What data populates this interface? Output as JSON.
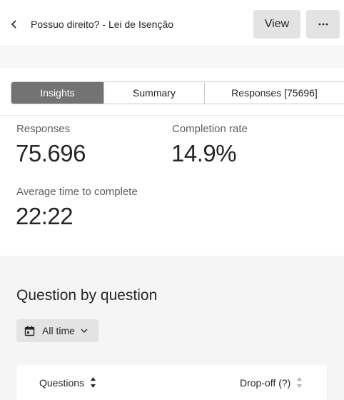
{
  "header": {
    "title": "Possuo direito? - Lei de Isenção",
    "view_label": "View"
  },
  "tabs": [
    {
      "label": "Insights",
      "active": true
    },
    {
      "label": "Summary",
      "active": false
    },
    {
      "label": "Responses [75696]",
      "active": false
    }
  ],
  "metrics": {
    "responses": {
      "label": "Responses",
      "value": "75.696"
    },
    "completion_rate": {
      "label": "Completion rate",
      "value": "14.9%"
    },
    "avg_time": {
      "label": "Average time to complete",
      "value": "22:22"
    }
  },
  "question_section": {
    "title": "Question by question",
    "time_filter": "All time",
    "columns": {
      "questions": "Questions",
      "dropoff": "Drop-off (?)"
    }
  },
  "icons": {
    "back": "chevron-left-icon",
    "more": "ellipsis-icon",
    "calendar": "calendar-icon",
    "dropdown": "chevron-down-icon",
    "sort": "sort-icon"
  },
  "colors": {
    "active_tab": "#737373",
    "button_bg": "#e3e3e3",
    "section_bg": "#f5f5f5"
  }
}
